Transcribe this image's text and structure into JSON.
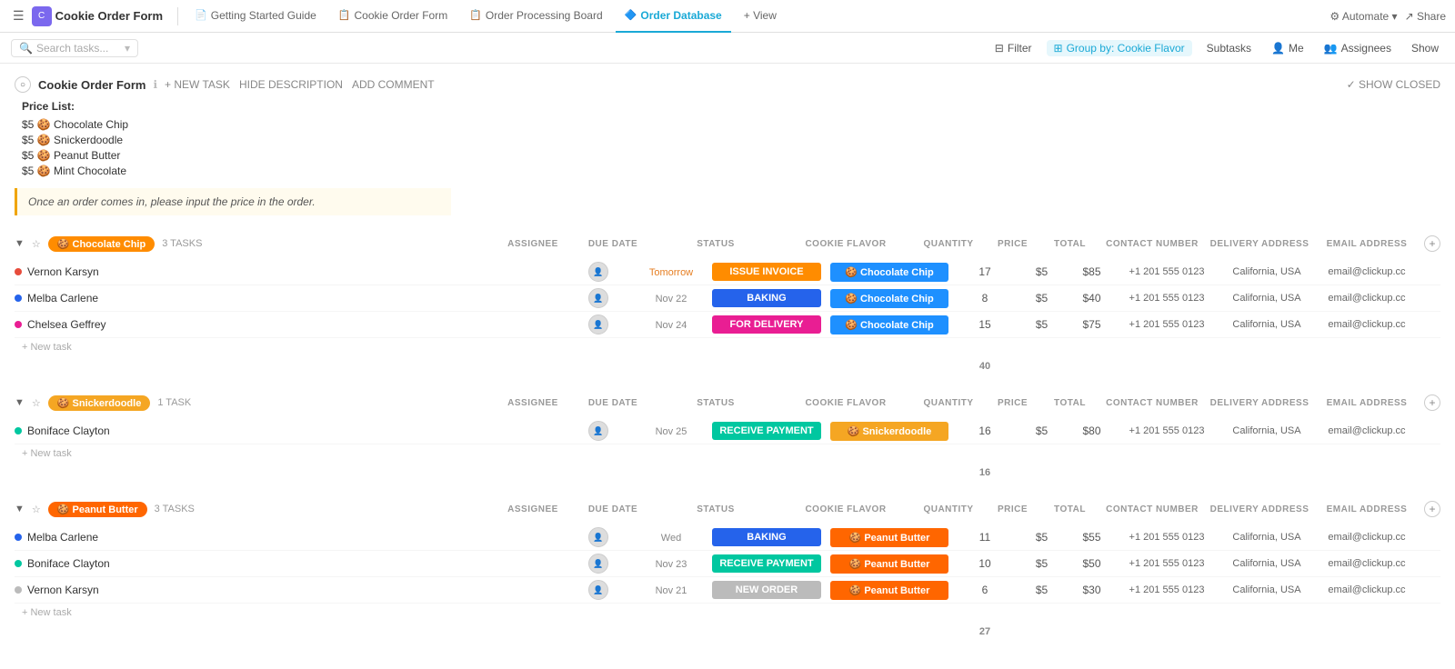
{
  "app": {
    "title": "Cookie Order Form",
    "hamburger": "☰"
  },
  "tabs": [
    {
      "label": "Getting Started Guide",
      "icon": "📄",
      "active": false
    },
    {
      "label": "Cookie Order Form",
      "icon": "📋",
      "active": false
    },
    {
      "label": "Order Processing Board",
      "icon": "📋",
      "active": false
    },
    {
      "label": "Order Database",
      "icon": "🔷",
      "active": true
    },
    {
      "label": "+ View",
      "icon": "",
      "active": false
    }
  ],
  "top_right": {
    "automate": "Automate",
    "share": "Share"
  },
  "toolbar": {
    "search_placeholder": "Search tasks...",
    "filter": "Filter",
    "group_by": "Group by: Cookie Flavor",
    "subtasks": "Subtasks",
    "me": "Me",
    "assignees": "Assignees",
    "show": "Show"
  },
  "section": {
    "title": "Cookie Order Form",
    "actions": [
      "+ NEW TASK",
      "HIDE DESCRIPTION",
      "ADD COMMENT"
    ],
    "show_closed": "✓ SHOW CLOSED"
  },
  "price_list": {
    "title": "Price List:",
    "items": [
      {
        "price": "$5",
        "emoji": "🍪",
        "flavor": "Chocolate Chip"
      },
      {
        "price": "$5",
        "emoji": "🍪",
        "flavor": "Snickerdoodle"
      },
      {
        "price": "$5",
        "emoji": "🍪",
        "flavor": "Peanut Butter"
      },
      {
        "price": "$5",
        "emoji": "🍪",
        "flavor": "Mint Chocolate"
      }
    ]
  },
  "notice": "Once an order comes in, please input the price in the order.",
  "col_headers": {
    "assignee": "ASSIGNEE",
    "due_date": "DUE DATE",
    "status": "STATUS",
    "cookie_flavor": "COOKIE FLAVOR",
    "quantity": "QUANTITY",
    "price": "PRICE",
    "total": "TOTAL",
    "contact": "CONTACT NUMBER",
    "address": "DELIVERY ADDRESS",
    "email": "EMAIL ADDRESS"
  },
  "groups": [
    {
      "id": "chocolate-chip",
      "label": "Chocolate Chip",
      "emoji": "🍪",
      "color_bg": "#ff8c00",
      "color_text": "#fff",
      "task_count": "3 TASKS",
      "collapsed": false,
      "tasks": [
        {
          "name": "Vernon Karsyn",
          "dot_color": "#e74c3c",
          "due_date": "Tomorrow",
          "due_class": "due-tomorrow",
          "status_label": "ISSUE INVOICE",
          "status_class": "status-issue",
          "flavor_label": "Chocolate Chip",
          "flavor_class": "flavor-choc",
          "flavor_emoji": "🍪",
          "quantity": 17,
          "price": "$5",
          "total": "$85",
          "contact": "+1 201 555 0123",
          "address": "California, USA",
          "email": "email@clickup.cc"
        },
        {
          "name": "Melba Carlene",
          "dot_color": "#2563eb",
          "due_date": "Nov 22",
          "due_class": "",
          "status_label": "BAKING",
          "status_class": "status-baking",
          "flavor_label": "Chocolate Chip",
          "flavor_class": "flavor-choc",
          "flavor_emoji": "🍪",
          "quantity": 8,
          "price": "$5",
          "total": "$40",
          "contact": "+1 201 555 0123",
          "address": "California, USA",
          "email": "email@clickup.cc"
        },
        {
          "name": "Chelsea Geffrey",
          "dot_color": "#e91e93",
          "due_date": "Nov 24",
          "due_class": "",
          "status_label": "FOR DELIVERY",
          "status_class": "status-delivery",
          "flavor_label": "Chocolate Chip",
          "flavor_class": "flavor-choc",
          "flavor_emoji": "🍪",
          "quantity": 15,
          "price": "$5",
          "total": "$75",
          "contact": "+1 201 555 0123",
          "address": "California, USA",
          "email": "email@clickup.cc"
        }
      ],
      "subtotal": 40
    },
    {
      "id": "snickerdoodle",
      "label": "Snickerdoodle",
      "emoji": "🍪",
      "color_bg": "#f5a623",
      "color_text": "#fff",
      "task_count": "1 TASK",
      "collapsed": false,
      "tasks": [
        {
          "name": "Boniface Clayton",
          "dot_color": "#00c7a0",
          "due_date": "Nov 25",
          "due_class": "",
          "status_label": "RECEIVE PAYMENT",
          "status_class": "status-receive",
          "flavor_label": "Snickerdoodle",
          "flavor_class": "flavor-snick",
          "flavor_emoji": "🍪",
          "quantity": 16,
          "price": "$5",
          "total": "$80",
          "contact": "+1 201 555 0123",
          "address": "California, USA",
          "email": "email@clickup.cc"
        }
      ],
      "subtotal": 16
    },
    {
      "id": "peanut-butter",
      "label": "Peanut Butter",
      "emoji": "🍪",
      "color_bg": "#ff6600",
      "color_text": "#fff",
      "task_count": "3 TASKS",
      "collapsed": false,
      "tasks": [
        {
          "name": "Melba Carlene",
          "dot_color": "#2563eb",
          "due_date": "Wed",
          "due_class": "",
          "status_label": "BAKING",
          "status_class": "status-baking",
          "flavor_label": "Peanut Butter",
          "flavor_class": "flavor-peanut",
          "flavor_emoji": "🍪",
          "quantity": 11,
          "price": "$5",
          "total": "$55",
          "contact": "+1 201 555 0123",
          "address": "California, USA",
          "email": "email@clickup.cc"
        },
        {
          "name": "Boniface Clayton",
          "dot_color": "#00c7a0",
          "due_date": "Nov 23",
          "due_class": "",
          "status_label": "RECEIVE PAYMENT",
          "status_class": "status-receive",
          "flavor_label": "Peanut Butter",
          "flavor_class": "flavor-peanut",
          "flavor_emoji": "🍪",
          "quantity": 10,
          "price": "$5",
          "total": "$50",
          "contact": "+1 201 555 0123",
          "address": "California, USA",
          "email": "email@clickup.cc"
        },
        {
          "name": "Vernon Karsyn",
          "dot_color": "#bbb",
          "due_date": "Nov 21",
          "due_class": "",
          "status_label": "NEW ORDER",
          "status_class": "status-new",
          "flavor_label": "Peanut Butter",
          "flavor_class": "flavor-peanut",
          "flavor_emoji": "🍪",
          "quantity": 6,
          "price": "$5",
          "total": "$30",
          "contact": "+1 201 555 0123",
          "address": "California, USA",
          "email": "email@clickup.cc"
        }
      ],
      "subtotal": 27
    }
  ]
}
